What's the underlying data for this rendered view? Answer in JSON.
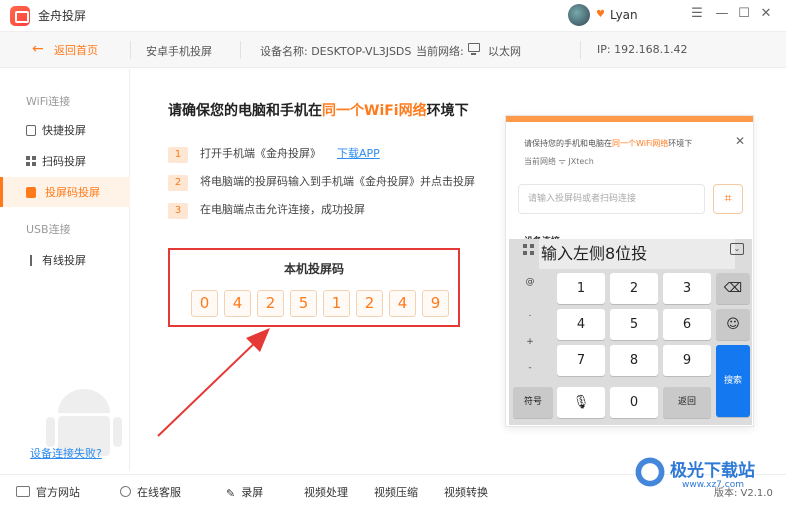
{
  "app": {
    "title": "金舟投屏",
    "user_name": "Lyan"
  },
  "window_controls": {
    "menu": "☰",
    "minimize": "—",
    "maximize": "☐",
    "close": "✕"
  },
  "infobar": {
    "back_label": "返回首页",
    "mode": "安卓手机投屏",
    "device_name": "设备名称: DESKTOP-VL3JSDS",
    "network_label": "当前网络:",
    "network_value": "以太网",
    "ip": "IP: 192.168.1.42"
  },
  "sidebar": {
    "wifi_section": "WiFi连接",
    "items": [
      {
        "label": "快捷投屏",
        "icon": "phone-icon"
      },
      {
        "label": "扫码投屏",
        "icon": "qr-grid-icon"
      },
      {
        "label": "投屏码投屏",
        "icon": "code-icon"
      }
    ],
    "usb_section": "USB连接",
    "usb_item": "有线投屏",
    "fail_link": "设备连接失败?"
  },
  "main": {
    "title_prefix": "请确保您的电脑和手机在",
    "title_highlight": "同一个WiFi网络",
    "title_suffix": "环境下",
    "steps": [
      {
        "num": "1",
        "text": "打开手机端《金舟投屏》",
        "link": "下载APP"
      },
      {
        "num": "2",
        "text": "将电脑端的投屏码输入到手机端《金舟投屏》并点击投屏"
      },
      {
        "num": "3",
        "text": "在电脑端点击允许连接，成功投屏"
      }
    ],
    "code_label": "本机投屏码",
    "digits": [
      "0",
      "4",
      "2",
      "5",
      "1",
      "2",
      "4",
      "9"
    ]
  },
  "phone": {
    "title_prefix": "请保持您的手机和电脑在",
    "title_highlight": "同一个WiFi网络",
    "title_suffix": "环境下",
    "network_label": "当前网络",
    "network_value": "JXtech",
    "input_placeholder": "请输入投屏码或者扫码连接",
    "device_section": "设备连接",
    "candidate_text": "输入左侧8位投",
    "keys": {
      "row1": [
        "1",
        "2",
        "3"
      ],
      "row2": [
        "4",
        "5",
        "6"
      ],
      "row3": [
        "7",
        "8",
        "9"
      ],
      "symbol_key": "符号",
      "zero": "0",
      "back_key": "返回",
      "search_key": "搜索",
      "side_symbols": [
        "@",
        ".",
        "+",
        "-"
      ]
    }
  },
  "bottombar": {
    "items": [
      "官方网站",
      "在线客服",
      "录屏",
      "视频处理",
      "视频压缩",
      "视频转换"
    ],
    "version": "版本: V2.1.0"
  },
  "watermark": {
    "text": "极光下载站",
    "url": "www.xz7.com"
  },
  "colors": {
    "accent": "#ff7a1a",
    "link": "#2d8cf0",
    "highlight_box": "#e53935",
    "key_blue": "#1478f0"
  }
}
